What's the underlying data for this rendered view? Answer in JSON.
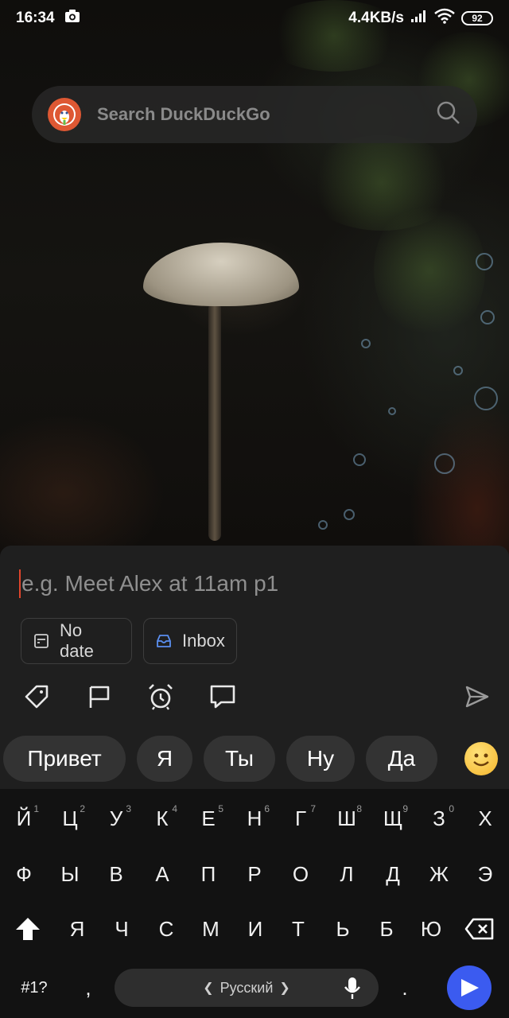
{
  "status_bar": {
    "time": "16:34",
    "speed": "4.4KB/s",
    "battery": "92",
    "icons": [
      "camera-icon",
      "signal-icon",
      "wifi-icon",
      "battery-icon"
    ]
  },
  "search_widget": {
    "placeholder": "Search DuckDuckGo",
    "icons": [
      "duckduckgo-logo",
      "search-icon"
    ]
  },
  "task_sheet": {
    "input_placeholder": "e.g. Meet Alex at 11am p1",
    "date_chip": "No date",
    "project_chip": "Inbox",
    "accent_color": "#e0452c",
    "project_icon_color": "#5b8ff0",
    "toolbar_icons": [
      "tag-icon",
      "flag-icon",
      "alarm-icon",
      "comment-icon",
      "send-icon"
    ]
  },
  "keyboard": {
    "suggestions": [
      "Привет",
      "Я",
      "Ты",
      "Ну",
      "Да"
    ],
    "row1": [
      "Й",
      "Ц",
      "У",
      "К",
      "Е",
      "Н",
      "Г",
      "Ш",
      "Щ",
      "З",
      "Х"
    ],
    "row1_hints": [
      "1",
      "2",
      "3",
      "4",
      "5",
      "6",
      "7",
      "8",
      "9",
      "0",
      ""
    ],
    "row2": [
      "Ф",
      "Ы",
      "В",
      "А",
      "П",
      "Р",
      "О",
      "Л",
      "Д",
      "Ж",
      "Э"
    ],
    "row3": [
      "Я",
      "Ч",
      "С",
      "М",
      "И",
      "Т",
      "Ь",
      "Б",
      "Ю"
    ],
    "symbols_key": "#1?",
    "comma_key": ",",
    "period_key": ".",
    "language": "Русский",
    "lang_prev": "❮",
    "lang_next": "❯",
    "enter_color": "#3b5bf0"
  }
}
